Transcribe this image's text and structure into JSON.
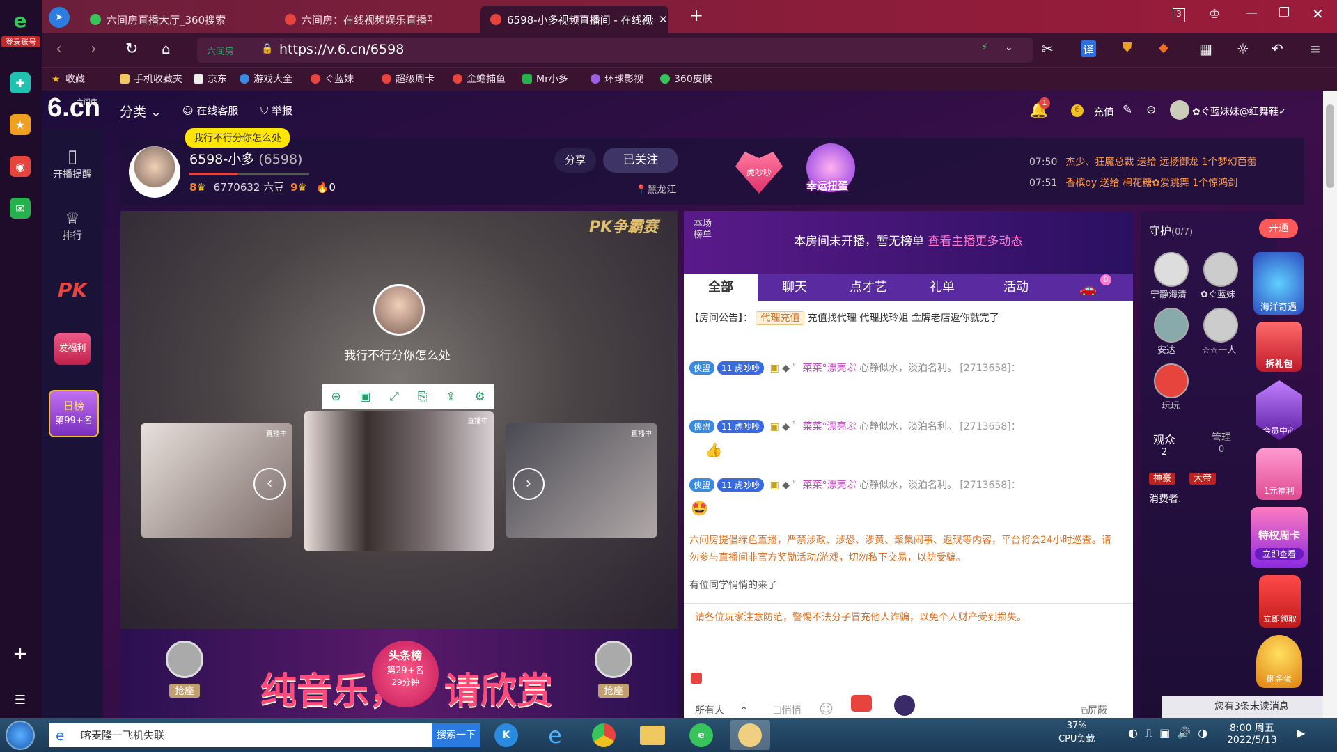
{
  "browser": {
    "sidebar_label": "登录账号",
    "tabs": [
      {
        "title": "六间房直播大厅_360搜索"
      },
      {
        "title": "六间房：在线视频娱乐直播平台"
      },
      {
        "title": "6598-小多视频直播间 - 在线视频"
      }
    ],
    "tab_count_badge": "3",
    "url": "https://v.6.cn/6598",
    "url_site_label": "六间房",
    "bookmarks": [
      "收藏",
      "手机收藏夹",
      "京东",
      "游戏大全",
      "ぐ蓝妹",
      "超级周卡",
      "金蟾捕鱼",
      "Mr小多",
      "环球影视",
      "360皮肤"
    ]
  },
  "site": {
    "logo": "6.cn",
    "logo_small": "六间房",
    "top_nav": {
      "category": "分类",
      "service": "在线客服",
      "report": "举报"
    },
    "notification_count": "1",
    "recharge": "充值",
    "username": "✿ぐ蓝妹妹@红舞鞋✓",
    "left_nav": [
      {
        "label": "开播提醒"
      },
      {
        "label": "排行"
      },
      {
        "label": "PK"
      },
      {
        "label": "发福利"
      },
      {
        "label": "日榜"
      },
      {
        "label": "第99+名"
      }
    ],
    "anchor": {
      "name": "6598-小多",
      "id": "(6598)",
      "bubble": "我行不行分你怎么处",
      "level_left": "8",
      "beans": "6770632 六豆",
      "level_right": "9",
      "fire_count": "0",
      "share": "分享",
      "followed": "已关注",
      "location": "黑龙江"
    },
    "promo": {
      "tiger": "虎吵吵",
      "egg": "幸运扭蛋"
    },
    "gift_feed": [
      {
        "time": "07:50",
        "text": "杰少、狂魔总裁 送给 远扬御龙 1个梦幻芭蕾"
      },
      {
        "time": "07:51",
        "text": "香槟oy 送给 棉花糖✿爱跳舞 1个惊鸿剑"
      }
    ],
    "player": {
      "pk_label": "PK争霸赛",
      "anchor_quote": "我行不行分你怎么处",
      "live_tag": "直播中",
      "banner_left": "纯音乐，",
      "banner_right": "请欣赏",
      "seat_label": "抢座",
      "toutiao": "头条榜",
      "toutiao_rank": "第29+名",
      "toutiao_time": "29分钟"
    },
    "chat": {
      "rank_label": "本场榜单",
      "rank_msg": "本房间未开播，暂无榜单",
      "rank_link": "查看主播更多动态",
      "tabs": [
        "全部",
        "聊天",
        "点才艺",
        "礼单",
        "活动"
      ],
      "car_count": "0",
      "notice_label": "【房间公告】：",
      "notice_tag": "代理充值",
      "notice_text": "充值找代理 代理找玲姐 金牌老店返你就完了",
      "messages": [
        {
          "badge1": "侠盟",
          "badge2": "虎吵吵",
          "level": "11",
          "user": "゜菜菜°漂亮ぷ",
          "sig": "心静似水，淡泊名利。",
          "uid": "[2713658]："
        },
        {
          "badge1": "侠盟",
          "badge2": "虎吵吵",
          "level": "11",
          "user": "゜菜菜°漂亮ぷ",
          "sig": "心静似水，淡泊名利。",
          "uid": "[2713658]："
        },
        {
          "badge1": "侠盟",
          "badge2": "虎吵吵",
          "level": "11",
          "user": "゜菜菜°漂亮ぷ",
          "sig": "心静似水，淡泊名利。",
          "uid": "[2713658]："
        }
      ],
      "system_msg": "六间房提倡绿色直播，严禁涉政、涉恐、涉黄、聚集闹事、返现等内容，平台将会24小时巡查。请勿参与直播间非官方奖励活动/游戏，切勿私下交易，以防受骗。",
      "join_msg": "有位同学悄悄的来了",
      "warning": "请各位玩家注意防范，警惕不法分子冒充他人诈骗，以免个人财产受到损失。",
      "target": "所有人",
      "whisper": "悄悄",
      "shield": "屏蔽"
    },
    "guard": {
      "title": "守护",
      "count": "(0/7)",
      "open": "开通",
      "members": [
        "宁静海清",
        "✿ぐ蓝妹",
        "安达",
        "☆☆一人",
        "玩玩"
      ],
      "tabs": [
        {
          "label": "观众",
          "count": "2"
        },
        {
          "label": "管理",
          "count": "0"
        }
      ],
      "consumer": "消费者.",
      "tag1": "神豪",
      "tag2": "大帝",
      "unread": "您有3条未读消息"
    },
    "right_promos": [
      "海洋奇遇",
      "拆礼包",
      "会员中心",
      "1元福利",
      "特权周卡",
      "立即查看",
      "立即领取",
      "砸金蛋"
    ]
  },
  "taskbar": {
    "search_text": "喀麦隆一飞机失联",
    "search_btn": "搜索一下",
    "cpu": "37%",
    "cpu_label": "CPU负载",
    "time": "8:00 周五",
    "date": "2022/5/13"
  }
}
